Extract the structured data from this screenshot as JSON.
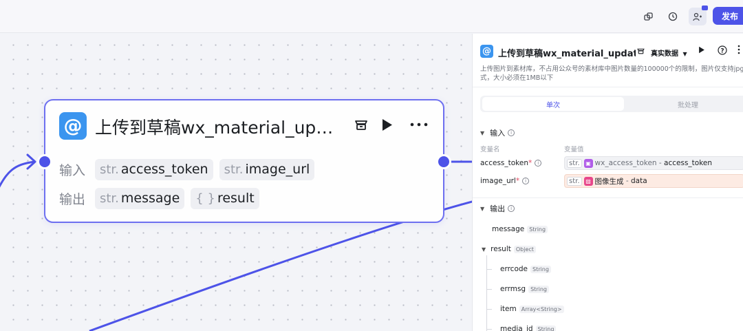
{
  "colors": {
    "accent": "#4d53e8",
    "node_icon": "#3b95ef",
    "edge": "#4d53e8"
  },
  "topbar": {
    "icons": [
      "copy-icon",
      "history-icon",
      "collaborator-icon"
    ],
    "publish_label": "发布"
  },
  "node": {
    "icon_glyph": "@",
    "title": "上传到草稿wx_material_up…",
    "input_label": "输入",
    "output_label": "输出",
    "inputs": [
      {
        "type": "str.",
        "name": "access_token"
      },
      {
        "type": "str.",
        "name": "image_url"
      }
    ],
    "outputs": [
      {
        "type": "str.",
        "name": "message"
      },
      {
        "type": "{ }",
        "name": "result"
      }
    ]
  },
  "panel": {
    "icon_glyph": "@",
    "title": "上传到草稿wx_material_updat…",
    "data_mode": "真实数据",
    "description_line1": "上传图片到素材库，不占用公众号的素材库中图片数量的100000个的限制，图片仅支持jpg/png格",
    "description_line2": "式，大小必须在1MB以下",
    "tab_single": "单次",
    "tab_batch": "批处理",
    "input_section": "输入",
    "col_var_name": "变量名",
    "col_var_value": "变量值",
    "inputs": [
      {
        "name": "access_token",
        "required": "*",
        "type": "str.",
        "source": "wx_access_token",
        "sep": " - ",
        "field": "access_token"
      },
      {
        "name": "image_url",
        "required": "*",
        "type": "str.",
        "source": "图像生成",
        "sep": " - ",
        "field": "data"
      }
    ],
    "output_section": "输出",
    "outputs": [
      {
        "name": "message",
        "type": "String"
      },
      {
        "name": "result",
        "type": "Object"
      },
      {
        "name": "errcode",
        "type": "String"
      },
      {
        "name": "errmsg",
        "type": "String"
      },
      {
        "name": "item",
        "type": "Array<String>"
      },
      {
        "name": "media_id",
        "type": "String"
      }
    ]
  }
}
